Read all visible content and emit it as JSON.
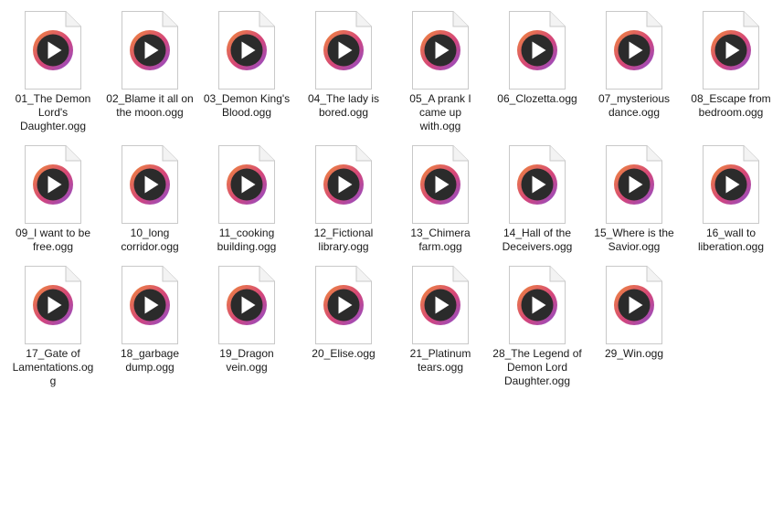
{
  "files": [
    {
      "name": "01_The Demon Lord's Daughter.ogg",
      "lines": [
        "01_The Demon",
        "Lord's",
        "Daughter.ogg"
      ]
    },
    {
      "name": "02_Blame it all on the moon.ogg",
      "lines": [
        "02_Blame it all on",
        "the moon.ogg"
      ]
    },
    {
      "name": "03_Demon King's Blood.ogg",
      "lines": [
        "03_Demon King's",
        "Blood.ogg"
      ]
    },
    {
      "name": "04_The lady is bored.ogg",
      "lines": [
        "04_The lady is",
        "bored.ogg"
      ]
    },
    {
      "name": "05_A prank I came up with.ogg",
      "lines": [
        "05_A prank I",
        "came up",
        "with.ogg"
      ]
    },
    {
      "name": "06_Clozetta.ogg",
      "lines": [
        "06_Clozetta.ogg"
      ]
    },
    {
      "name": "07_mysterious dance.ogg",
      "lines": [
        "07_mysterious",
        "dance.ogg"
      ]
    },
    {
      "name": "08_Escape from bedroom.ogg",
      "lines": [
        "08_Escape from",
        "bedroom.ogg"
      ]
    },
    {
      "name": "09_I want to be free.ogg",
      "lines": [
        "09_I want to be",
        "free.ogg"
      ]
    },
    {
      "name": "10_long corridor.ogg",
      "lines": [
        "10_long",
        "corridor.ogg"
      ]
    },
    {
      "name": "11_cooking building.ogg",
      "lines": [
        "11_cooking",
        "building.ogg"
      ]
    },
    {
      "name": "12_Fictional library.ogg",
      "lines": [
        "12_Fictional",
        "library.ogg"
      ]
    },
    {
      "name": "13_Chimera farm.ogg",
      "lines": [
        "13_Chimera",
        "farm.ogg"
      ]
    },
    {
      "name": "14_Hall of the Deceivers.ogg",
      "lines": [
        "14_Hall of the",
        "Deceivers.ogg"
      ]
    },
    {
      "name": "15_Where is the Savior.ogg",
      "lines": [
        "15_Where is the",
        "Savior.ogg"
      ]
    },
    {
      "name": "16_wall to liberation.ogg",
      "lines": [
        "16_wall to",
        "liberation.ogg"
      ]
    },
    {
      "name": "17_Gate of Lamentations.ogg",
      "lines": [
        "17_Gate of",
        "Lamentations.og",
        "g"
      ]
    },
    {
      "name": "18_garbage dump.ogg",
      "lines": [
        "18_garbage",
        "dump.ogg"
      ]
    },
    {
      "name": "19_Dragon vein.ogg",
      "lines": [
        "19_Dragon",
        "vein.ogg"
      ]
    },
    {
      "name": "20_Elise.ogg",
      "lines": [
        "20_Elise.ogg"
      ]
    },
    {
      "name": "21_Platinum tears.ogg",
      "lines": [
        "21_Platinum",
        "tears.ogg"
      ]
    },
    {
      "name": "28_The Legend of Demon Lord Daughter.ogg",
      "lines": [
        "28_The Legend of",
        "Demon Lord",
        "Daughter.ogg"
      ]
    },
    {
      "name": "29_Win.ogg",
      "lines": [
        "29_Win.ogg"
      ]
    }
  ],
  "icon": {
    "name": "audio-file-icon",
    "ring_colors": [
      "#f08a3a",
      "#d4457a",
      "#8a4fd0"
    ],
    "disc_color": "#2b2b2b",
    "play_color": "#ffffff"
  }
}
